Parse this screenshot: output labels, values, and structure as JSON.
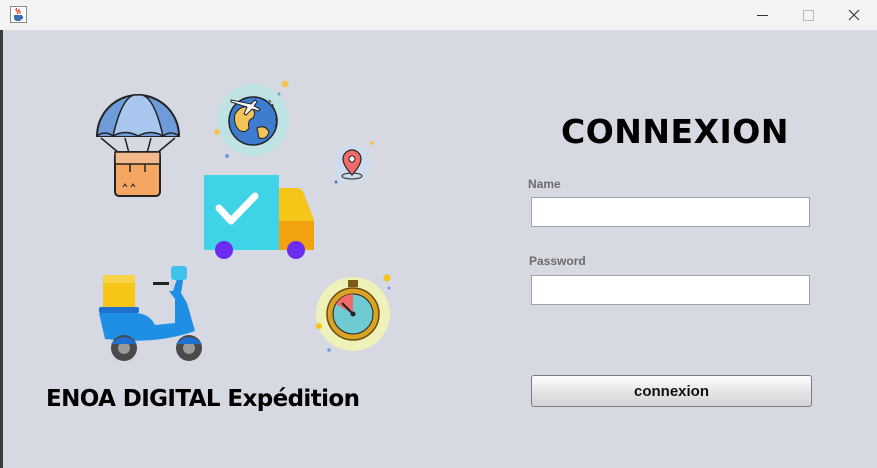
{
  "window": {
    "title": "",
    "icon": "java-cup-icon",
    "controls": [
      "minimize-icon",
      "maximize-icon",
      "close-icon"
    ]
  },
  "branding": {
    "company_name": "ENOA DIGITAL Expédition"
  },
  "login": {
    "title": "CONNEXION",
    "name_label": "Name",
    "name_value": "",
    "password_label": "Password",
    "password_value": "",
    "submit_label": "connexion"
  },
  "illustrations": [
    "parachute-package-icon",
    "globe-airplane-icon",
    "location-pin-icon",
    "delivery-truck-check-icon",
    "delivery-scooter-icon",
    "stopwatch-icon"
  ],
  "colors": {
    "background": "#d6d9e1",
    "truck_cargo": "#3fd3e8",
    "truck_cab": "#f5c518",
    "wheels": "#6a2cf0",
    "scooter": "#1f8fe6"
  }
}
